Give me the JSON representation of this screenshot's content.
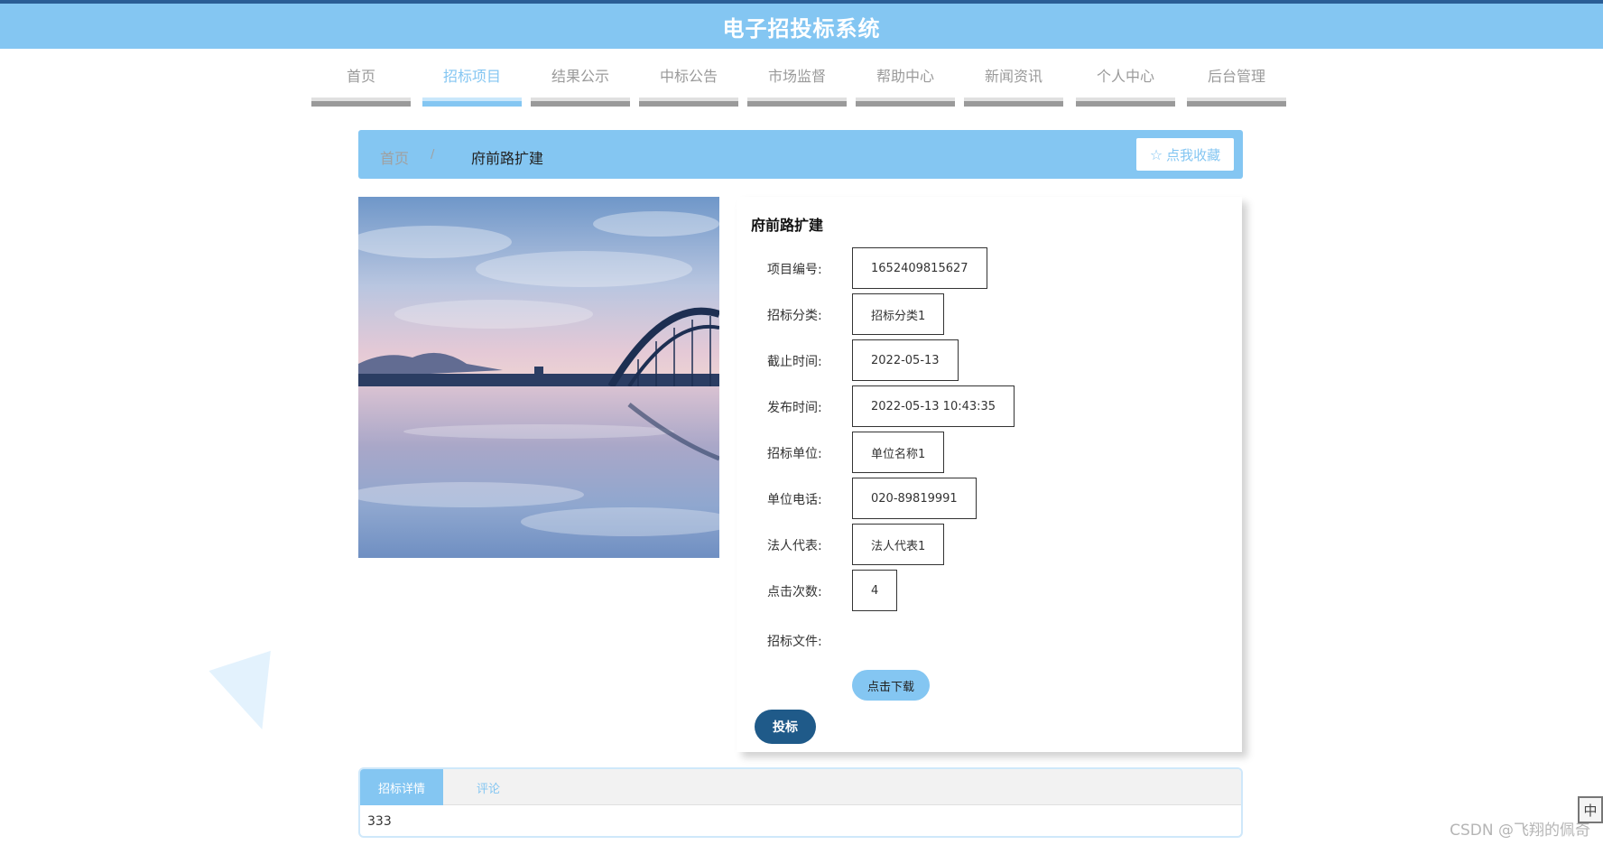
{
  "header": {
    "title": "电子招投标系统"
  },
  "nav": {
    "items": [
      {
        "label": "首页"
      },
      {
        "label": "招标项目"
      },
      {
        "label": "结果公示"
      },
      {
        "label": "中标公告"
      },
      {
        "label": "市场监督"
      },
      {
        "label": "帮助中心"
      },
      {
        "label": "新闻资讯"
      },
      {
        "label": "个人中心"
      },
      {
        "label": "后台管理"
      }
    ],
    "active_index": 1
  },
  "breadcrumb": {
    "home": "首页",
    "separator": "/",
    "current": "府前路扩建",
    "favorite_label": "点我收藏"
  },
  "detail": {
    "title": "府前路扩建",
    "fields": [
      {
        "label": "项目编号:",
        "value": "1652409815627"
      },
      {
        "label": "招标分类:",
        "value": "招标分类1"
      },
      {
        "label": "截止时间:",
        "value": "2022-05-13"
      },
      {
        "label": "发布时间:",
        "value": "2022-05-13 10:43:35"
      },
      {
        "label": "招标单位:",
        "value": "单位名称1"
      },
      {
        "label": "单位电话:",
        "value": "020-89819991"
      },
      {
        "label": "法人代表:",
        "value": "法人代表1"
      },
      {
        "label": "点击次数:",
        "value": "4"
      }
    ],
    "file_label": "招标文件:",
    "download_label": "点击下载",
    "bid_label": "投标"
  },
  "tabs": {
    "items": [
      {
        "label": "招标详情"
      },
      {
        "label": "评论"
      }
    ],
    "content": "333"
  },
  "watermark": "CSDN @飞翔的佩奇",
  "corner_glyph": "中",
  "colors": {
    "accent": "#84c6f2",
    "primary_dark": "#1f5a89",
    "top_line": "#2a5d95"
  }
}
